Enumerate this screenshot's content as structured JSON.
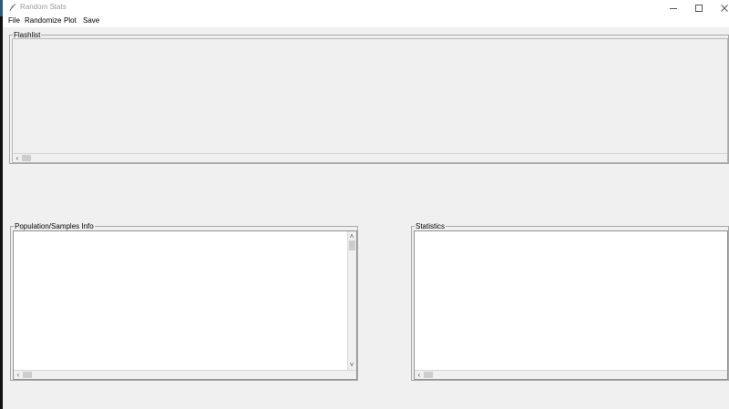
{
  "window": {
    "title": "Random Stats",
    "icon": "feather-icon",
    "controls": [
      "minimize-icon",
      "maximize-icon",
      "close-icon"
    ]
  },
  "menu": {
    "items": [
      {
        "label": "File"
      },
      {
        "label": "Randomize"
      },
      {
        "label": "Plot"
      },
      {
        "label": "Save"
      }
    ]
  },
  "panels": {
    "flashlist": {
      "label": "Flashlist"
    },
    "population": {
      "label": "Population/Samples Info"
    },
    "statistics": {
      "label": "Statistics"
    }
  },
  "scroll_glyphs": {
    "left": "‹",
    "up": "˄",
    "down": "˅"
  }
}
